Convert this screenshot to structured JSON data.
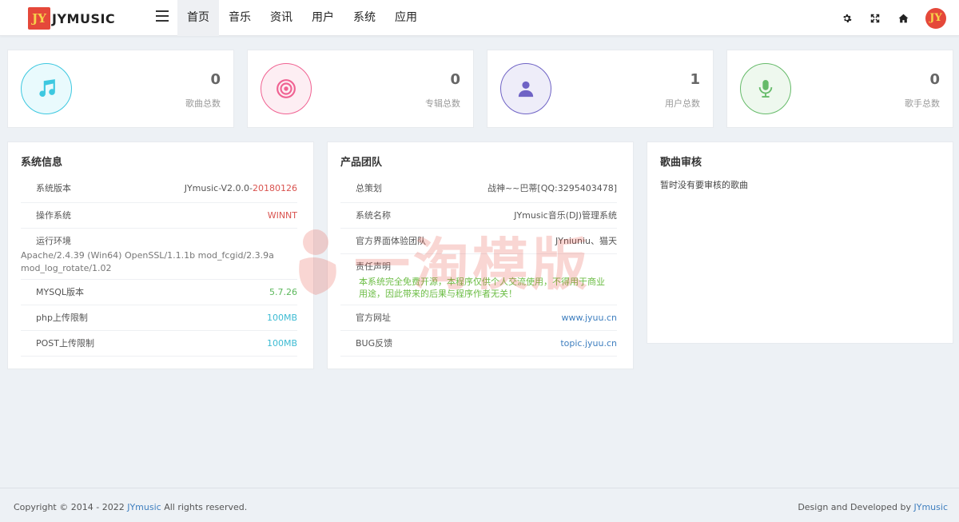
{
  "header": {
    "logo_badge": "JY",
    "logo_text": "JYMUSIC",
    "nav": [
      "首页",
      "音乐",
      "资讯",
      "用户",
      "系统",
      "应用"
    ],
    "avatar": "JY"
  },
  "stats": [
    {
      "value": "0",
      "label": "歌曲总数",
      "icon": "music-note-icon",
      "color": "#3dc8e0"
    },
    {
      "value": "0",
      "label": "专辑总数",
      "icon": "target-disc-icon",
      "color": "#f06292"
    },
    {
      "value": "1",
      "label": "用户总数",
      "icon": "user-icon",
      "color": "#6f63c5"
    },
    {
      "value": "0",
      "label": "歌手总数",
      "icon": "microphone-icon",
      "color": "#66bb6a"
    }
  ],
  "system_panel": {
    "title": "系统信息",
    "version_label": "系统版本",
    "version_prefix": "JYmusic-V2.0.0-",
    "version_build": "20180126",
    "os_label": "操作系统",
    "os_value": "WINNT",
    "env_label": "运行环境",
    "env_value_1": "Apache/2.4.39 (Win64) OpenSSL/1.1.1b mod_fcgid/2.3.9a",
    "env_value_2": "mod_log_rotate/1.02",
    "mysql_label": "MYSQL版本",
    "mysql_value": "5.7.26",
    "php_label": "php上传限制",
    "php_value": "100MB",
    "post_label": "POST上传限制",
    "post_value": "100MB"
  },
  "team_panel": {
    "title": "产品团队",
    "planner_label": "总策划",
    "planner_value": "战神~~巴蒂[QQ:3295403478]",
    "sysname_label": "系统名称",
    "sysname_value": "JYmusic音乐(DJ)管理系统",
    "ui_label": "官方界面体验团队",
    "ui_value": "JYniuniu、猫天",
    "disclaimer_label": "责任声明",
    "disclaimer_1": "本系统完全免费开源，本程序仅供个人交流使用，不得用于商业",
    "disclaimer_2": "用途，因此带来的后果与程序作者无关！",
    "site_label": "官方网址",
    "site_value": "www.jyuu.cn",
    "bug_label": "BUG反馈",
    "bug_value": "topic.jyuu.cn"
  },
  "review_panel": {
    "title": "歌曲审核",
    "empty_text": "暂时没有要审核的歌曲"
  },
  "watermark": {
    "text": "一淘模版"
  },
  "footer": {
    "copyright_prefix": "Copyright © 2014 - 2022 ",
    "copyright_brand": "JYmusic",
    "copyright_suffix": " All rights reserved.",
    "credit_prefix": "Design and Developed by ",
    "credit_brand": "JYmusic"
  }
}
